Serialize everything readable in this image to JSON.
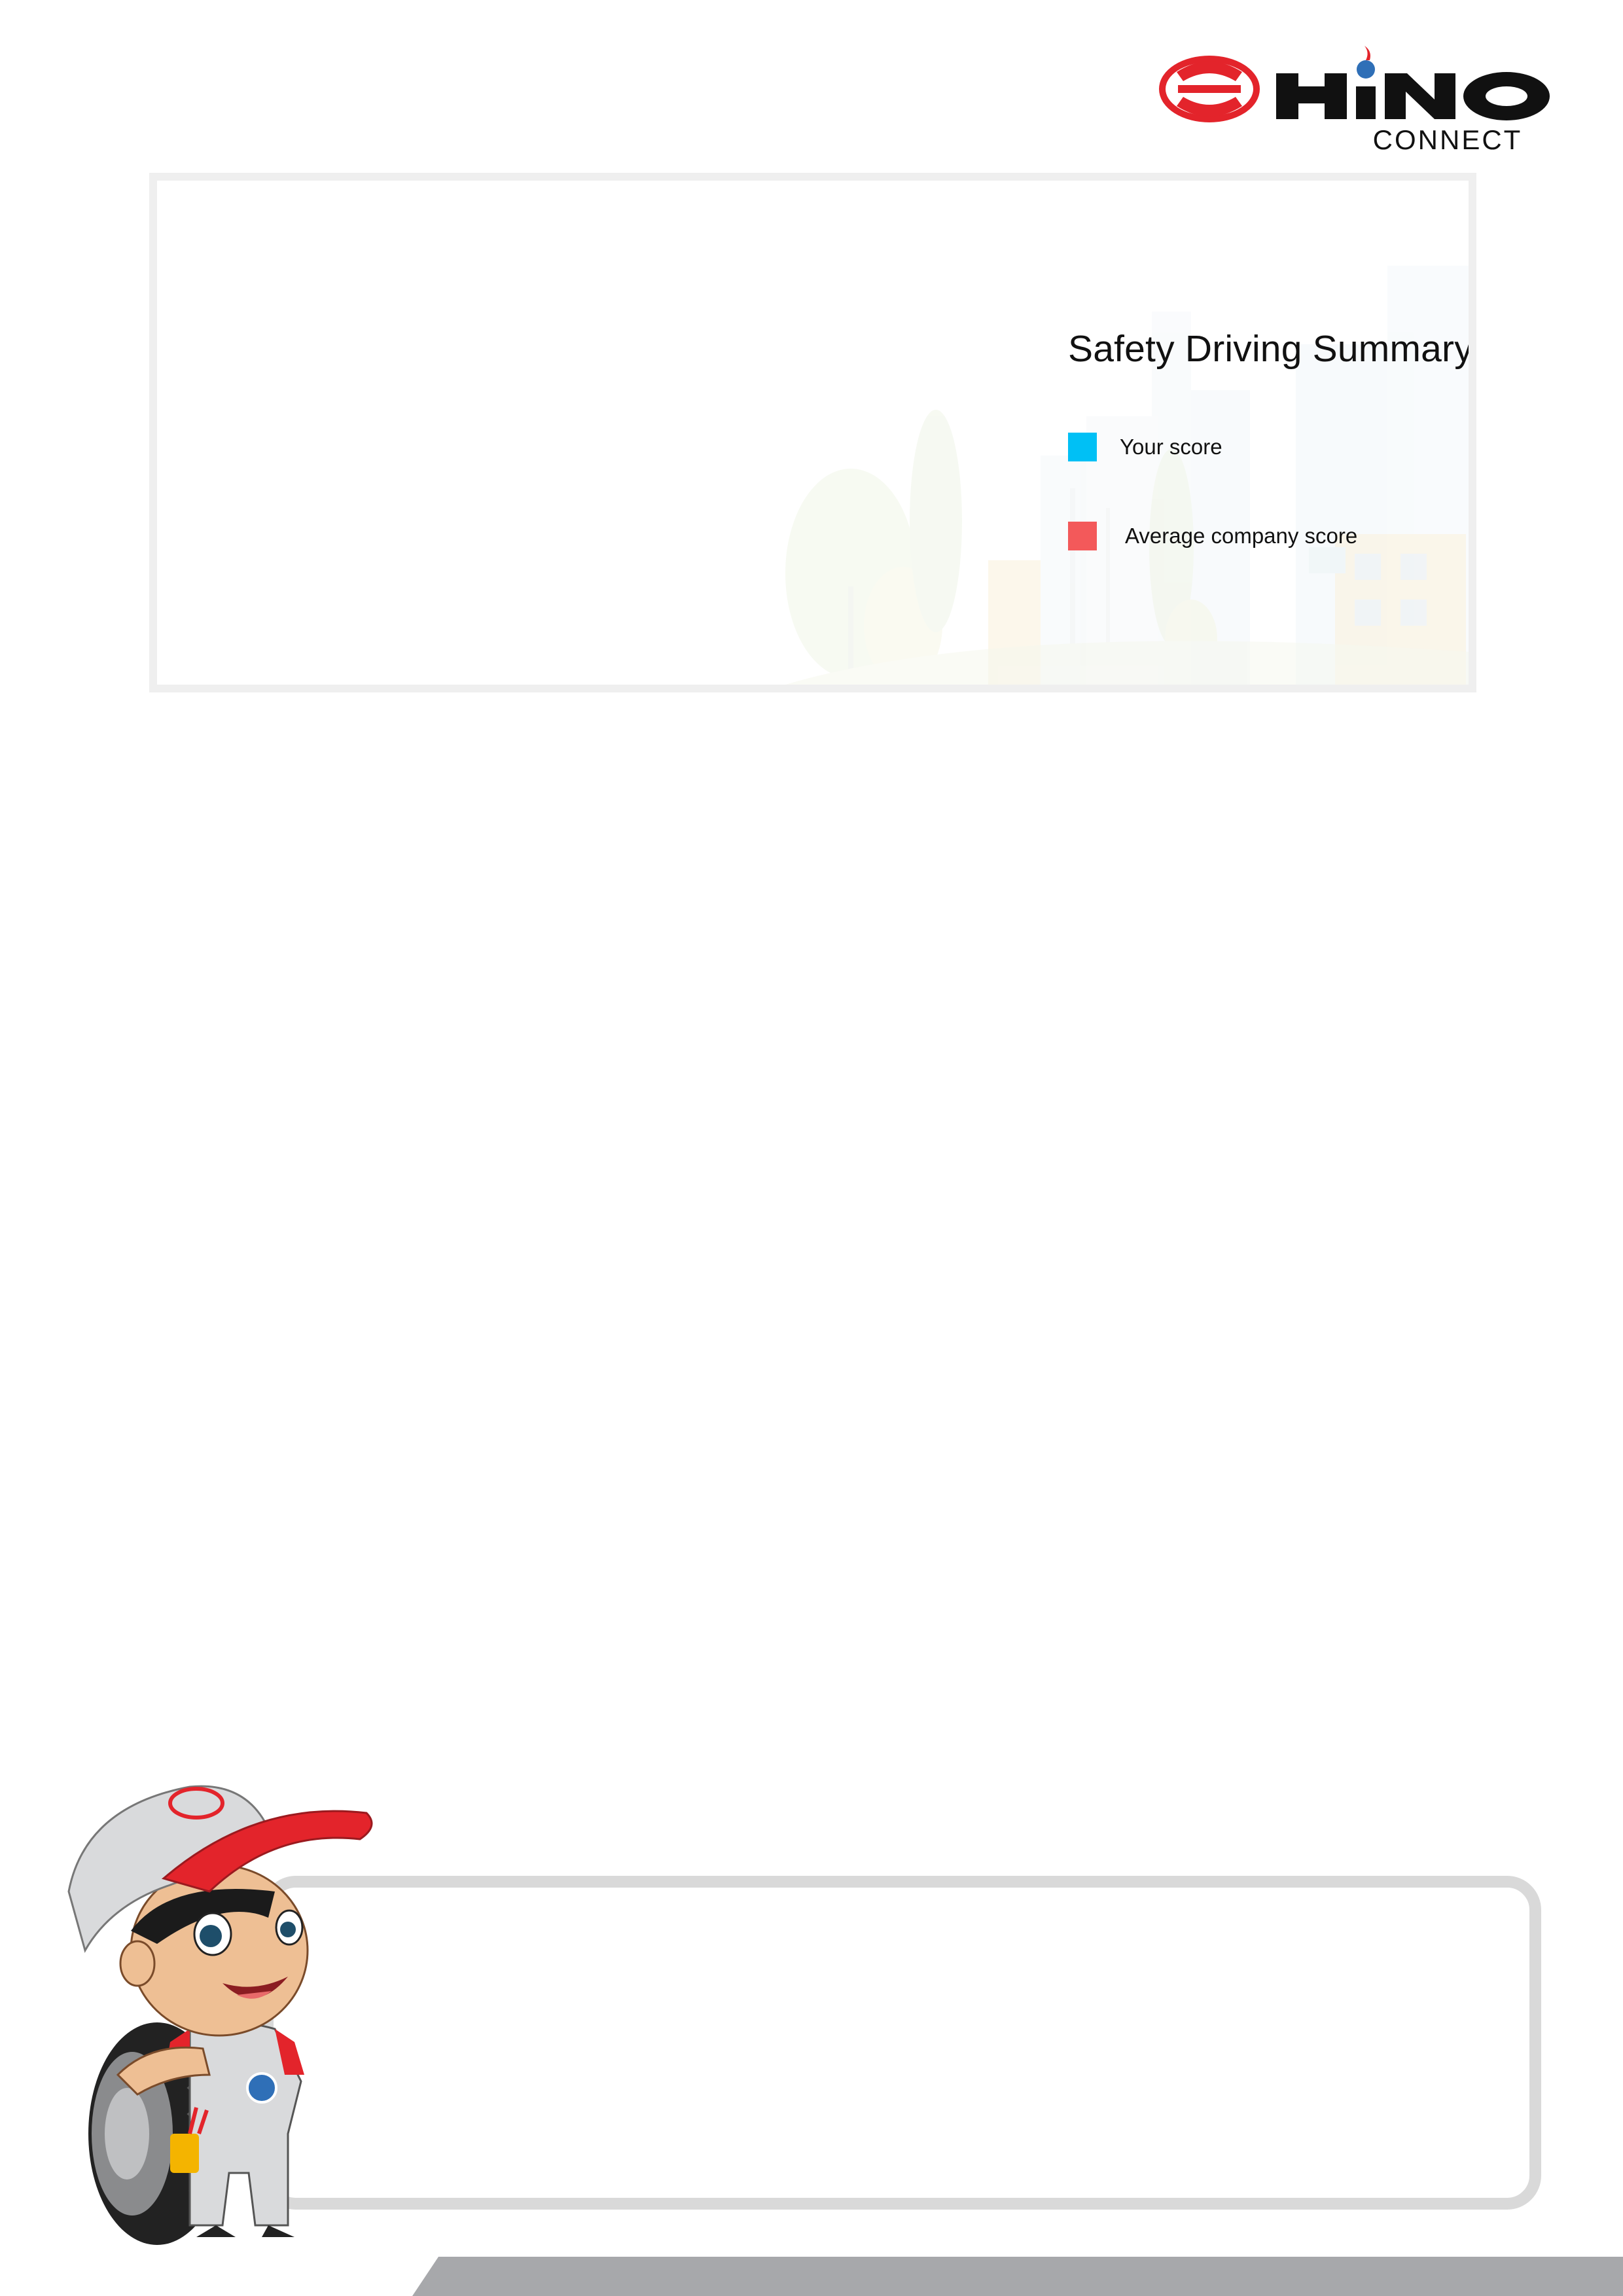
{
  "brand": {
    "wordmark": "HINO",
    "subtitle": "CONNECT",
    "colors": {
      "red": "#e3242b",
      "black": "#111111",
      "globe_blue": "#2f6fb7"
    }
  },
  "summary": {
    "title": "Safety Driving Summary",
    "legend": [
      {
        "label": "Your score",
        "color": "#00c0f5"
      },
      {
        "label": "Average company score",
        "color": "#f3595a"
      }
    ]
  },
  "illustrations": {
    "background": "city-park-illustration",
    "mascot": "hino-mechanic-mascot-with-tire"
  },
  "colors": {
    "card_border": "#efefef",
    "message_border": "#d9d9d9",
    "footer_band": "#a7a8ab"
  }
}
